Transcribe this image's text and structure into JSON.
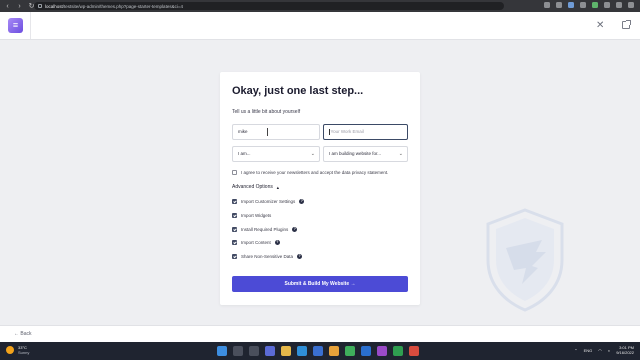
{
  "browser": {
    "url_host": "localhost",
    "url_path": "/testsite/wp-admin/themes.php?page-starter-templates&ci=4"
  },
  "card": {
    "title": "Okay, just one last step...",
    "subtitle": "Tell us a little bit about yourself",
    "name_value": "mike",
    "email_placeholder": "Your Work Email",
    "role_select": "I am...",
    "purpose_select": "I am building website for...",
    "newsletter_label": "I agree to receive your newsletters and accept the data privacy statement.",
    "advanced_label": "Advanced Options",
    "options": [
      {
        "label": "Import Customizer Settings",
        "checked": true,
        "info": true
      },
      {
        "label": "Import Widgets",
        "checked": true,
        "info": false
      },
      {
        "label": "Install Required Plugins",
        "checked": true,
        "info": true
      },
      {
        "label": "Import Content",
        "checked": true,
        "info": true
      },
      {
        "label": "Share Non-Sensitive Data",
        "checked": true,
        "info": true
      }
    ],
    "submit_label": "Submit & Build My Website",
    "submit_arrow": "→"
  },
  "footer": {
    "back_label": "← Back"
  },
  "taskbar": {
    "temp": "33°C",
    "condition": "Sunny",
    "lang": "ENG",
    "time": "3:01 PM",
    "date": "9/16/2022"
  },
  "colors": {
    "accent": "#4c4bd6",
    "checkbox": "#414a63"
  }
}
